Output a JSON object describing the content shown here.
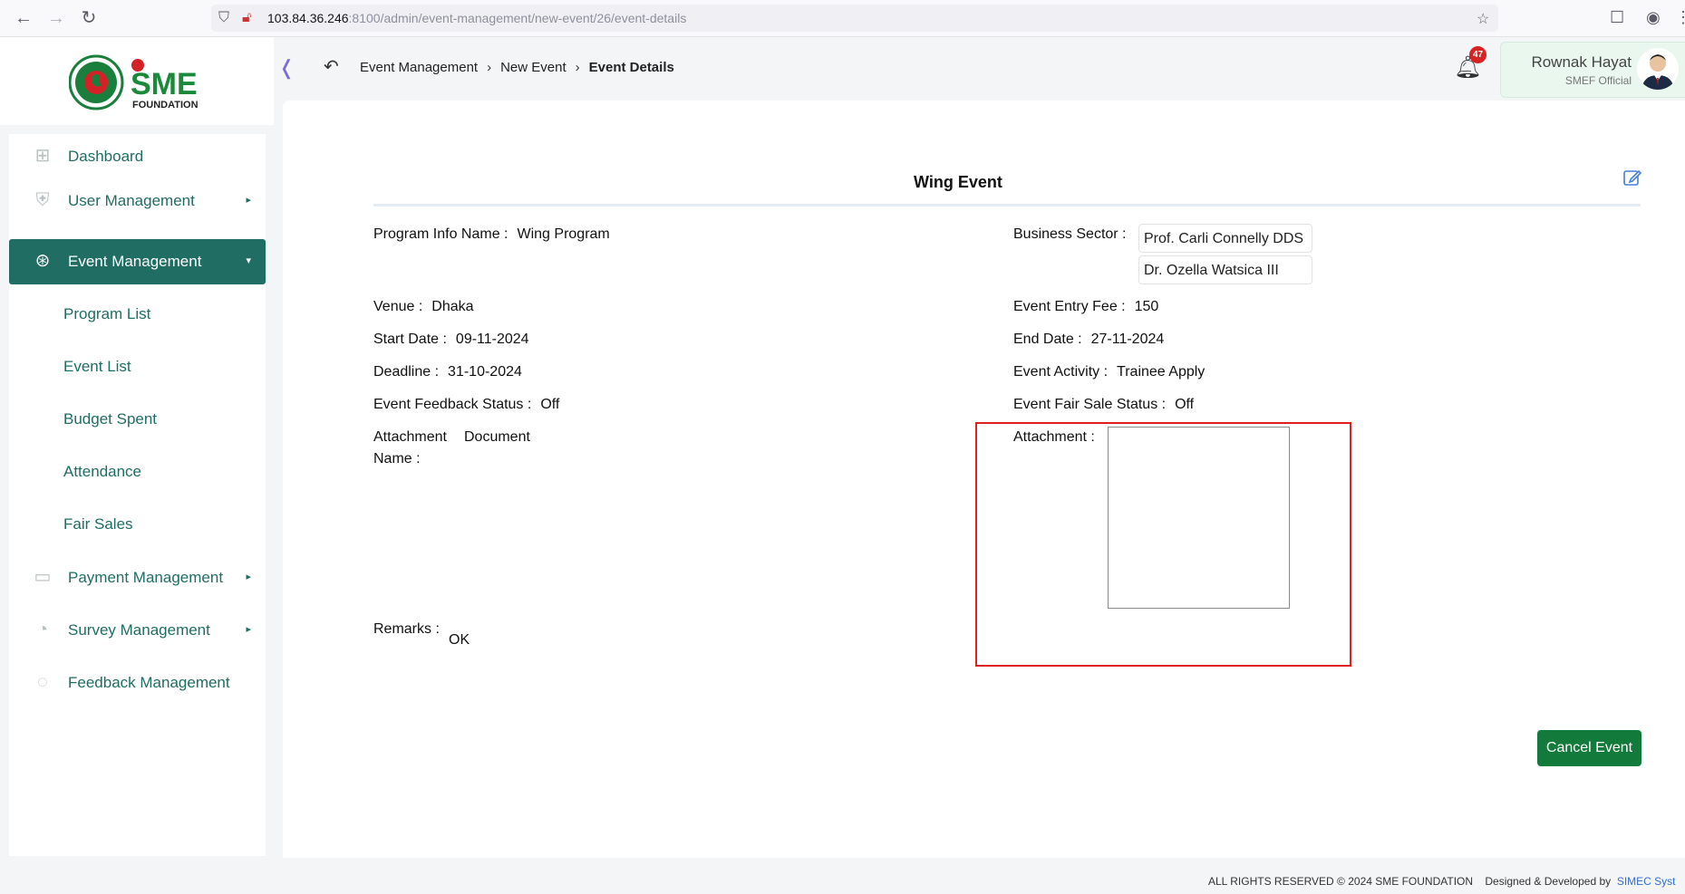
{
  "browser": {
    "url_host": "103.84.36.246",
    "url_rest": ":8100/admin/event-management/new-event/26/event-details"
  },
  "brand": {
    "logo_text": "SME",
    "logo_sub": "FOUNDATION",
    "green": "#1f6d63"
  },
  "sidebar": {
    "items": [
      {
        "label": "Dashboard",
        "icon": "grid-icon"
      },
      {
        "label": "User Management",
        "icon": "user-shield-icon"
      },
      {
        "label": "Event Management",
        "icon": "lock-icon"
      },
      {
        "label": "Payment Management",
        "icon": "money-icon"
      },
      {
        "label": "Survey Management",
        "icon": "pie-icon"
      },
      {
        "label": "Feedback Management",
        "icon": "feedback-icon"
      }
    ],
    "sub_items": [
      "Program List",
      "Event List",
      "Budget Spent",
      "Attendance",
      "Fair Sales"
    ]
  },
  "header": {
    "breadcrumb": [
      "Event Management",
      "New Event",
      "Event Details"
    ],
    "notification_count": "47",
    "user_name": "Rownak Hayat",
    "user_role": "SMEF Official"
  },
  "event": {
    "title": "Wing Event",
    "program_label": "Program Info Name :",
    "program_value": "Wing Program",
    "sector_label": "Business Sector :",
    "sectors": [
      "Prof. Carli Connelly DDS",
      "Dr. Ozella Watsica III"
    ],
    "venue_label": "Venue :",
    "venue_value": "Dhaka",
    "fee_label": "Event Entry Fee :",
    "fee_value": "150",
    "start_label": "Start Date :",
    "start_value": "09-11-2024",
    "end_label": "End Date :",
    "end_value": "27-11-2024",
    "deadline_label": "Deadline :",
    "deadline_value": "31-10-2024",
    "activity_label": "Event Activity :",
    "activity_value": "Trainee Apply",
    "feedback_label": "Event Feedback Status :",
    "feedback_value": "Off",
    "fairsale_label": "Event Fair Sale Status :",
    "fairsale_value": "Off",
    "attach_name_label_1": "Attachment",
    "attach_name_label_2": "Name :",
    "attach_name_value": "Document",
    "attachment_label": "Attachment :",
    "remarks_label": "Remarks :",
    "remarks_value": "OK",
    "cancel_label": "Cancel Event"
  },
  "footer": {
    "rights": "ALL RIGHTS RESERVED © 2024 SME FOUNDATION",
    "designed": "Designed & Developed by",
    "company": "SIMEC Syst"
  }
}
